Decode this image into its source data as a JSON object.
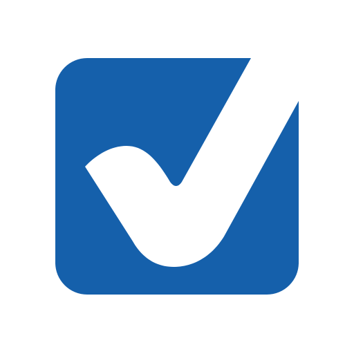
{
  "icon": {
    "name": "checkbox-check-icon",
    "colors": {
      "background": "#ffffff",
      "box": "#1560ab",
      "check": "#ffffff"
    }
  }
}
